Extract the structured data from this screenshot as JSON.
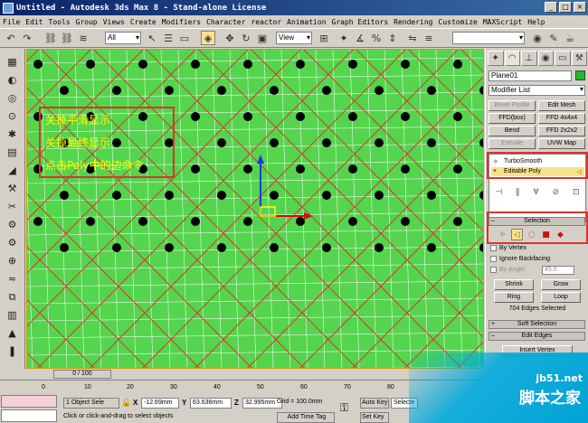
{
  "window": {
    "title": "Untitled - Autodesk 3ds Max 8 - Stand-alone License",
    "controls": [
      "_",
      "□",
      "×"
    ]
  },
  "menu": [
    "File",
    "Edit",
    "Tools",
    "Group",
    "Views",
    "Create",
    "Modifiers",
    "Character",
    "reactor",
    "Animation",
    "Graph Editors",
    "Rendering",
    "Customize",
    "MAXScript",
    "Help"
  ],
  "toolbar": {
    "filter_value": "All",
    "coord_value": "View"
  },
  "viewport": {
    "annotation_lines": [
      "关掉平滑显示",
      "关掉最终显示",
      "点击Poly中的边命令"
    ],
    "colors": {
      "background": "#55d44e",
      "grid": "#ffffff",
      "edge": "#d8362a",
      "vertex": "#000000"
    }
  },
  "command_panel": {
    "object_name": "Plane01",
    "object_color": "#22bb22",
    "modifier_list_label": "Modifier List",
    "modifier_buttons": [
      {
        "label": "Bevel Profile",
        "disabled": true
      },
      {
        "label": "Edit Mesh",
        "disabled": false
      },
      {
        "label": "FFD(box)",
        "disabled": false
      },
      {
        "label": "FFD 4x4x4",
        "disabled": false
      },
      {
        "label": "Bend",
        "disabled": false
      },
      {
        "label": "FFD 2x2x2",
        "disabled": false
      },
      {
        "label": "Extrude",
        "disabled": true
      },
      {
        "label": "UVW Map",
        "disabled": false
      }
    ],
    "stack": [
      "TurboSmooth",
      "Editable Poly"
    ],
    "selection_rollout": {
      "title": "Selection",
      "by_vertex": "By Vertex",
      "ignore_backfacing": "Ignore Backfacing",
      "by_angle": "By Angle:",
      "angle_value": "45.0",
      "shrink": "Shrink",
      "grow": "Grow",
      "ring": "Ring",
      "loop": "Loop",
      "status": "704 Edges Selected"
    },
    "soft_selection": "Soft Selection",
    "edit_edges": "Edit Edges",
    "insert_vertex": "Insert Vertex"
  },
  "timeline": {
    "frame_label": "0 / 100",
    "ticks": [
      "0",
      "10",
      "20",
      "30",
      "40",
      "50",
      "60",
      "70",
      "80"
    ]
  },
  "status_bar": {
    "selection": "1 Object Sele",
    "x_label": "X",
    "x_value": "-12.69mm",
    "y_label": "Y",
    "y_value": "63.636mm",
    "z_label": "Z",
    "z_value": "32.995mm",
    "grid": "Grid = 100.0mm",
    "auto_key": "Auto Key",
    "selected": "Selecte",
    "set_key": "Set Key",
    "prompt": "Click or click-and-drag to select objects",
    "add_time_tag": "Add Time Tag"
  },
  "watermark": {
    "site": "jb51.net",
    "name": "脚本之家"
  }
}
